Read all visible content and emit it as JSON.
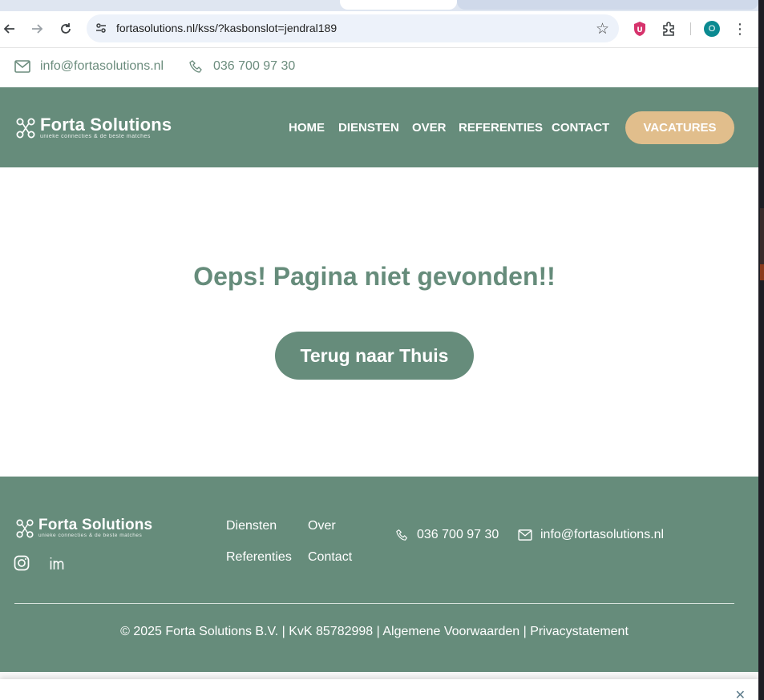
{
  "browser": {
    "url": "fortasolutions.nl/kss/?kasbonslot=jendral189",
    "profile_initial": "O"
  },
  "topbar": {
    "email": "info@fortasolutions.nl",
    "phone": "036 700 97 30"
  },
  "header": {
    "logo_name": "Forta Solutions",
    "logo_tagline": "unieke connecties & de beste matches",
    "nav": [
      "HOME",
      "DIENSTEN",
      "OVER",
      "REFERENTIES",
      "CONTACT"
    ],
    "cta": "VACATURES"
  },
  "main": {
    "title": "Oeps! Pagina niet gevonden!!",
    "button": "Terug naar Thuis"
  },
  "footer": {
    "logo_name": "Forta Solutions",
    "logo_tagline": "unieke connecties & de beste matches",
    "links": [
      "Diensten",
      "Over",
      "Referenties",
      "Contact"
    ],
    "phone": "036 700 97 30",
    "email": "info@fortasolutions.nl",
    "legal": "© 2025 Forta Solutions B.V. | KvK 85782998 | Algemene Voorwaarden | Privacystatement"
  },
  "colors": {
    "brand_green": "#668c7b",
    "accent_gold": "#e1be8c"
  },
  "icons": [
    "back-icon",
    "forward-icon",
    "reload-icon",
    "site-settings-icon",
    "star-icon",
    "extension-shield-icon",
    "puzzle-icon",
    "menu-icon",
    "mail-icon",
    "phone-icon",
    "instagram-icon",
    "linkedin-icon",
    "close-icon"
  ]
}
